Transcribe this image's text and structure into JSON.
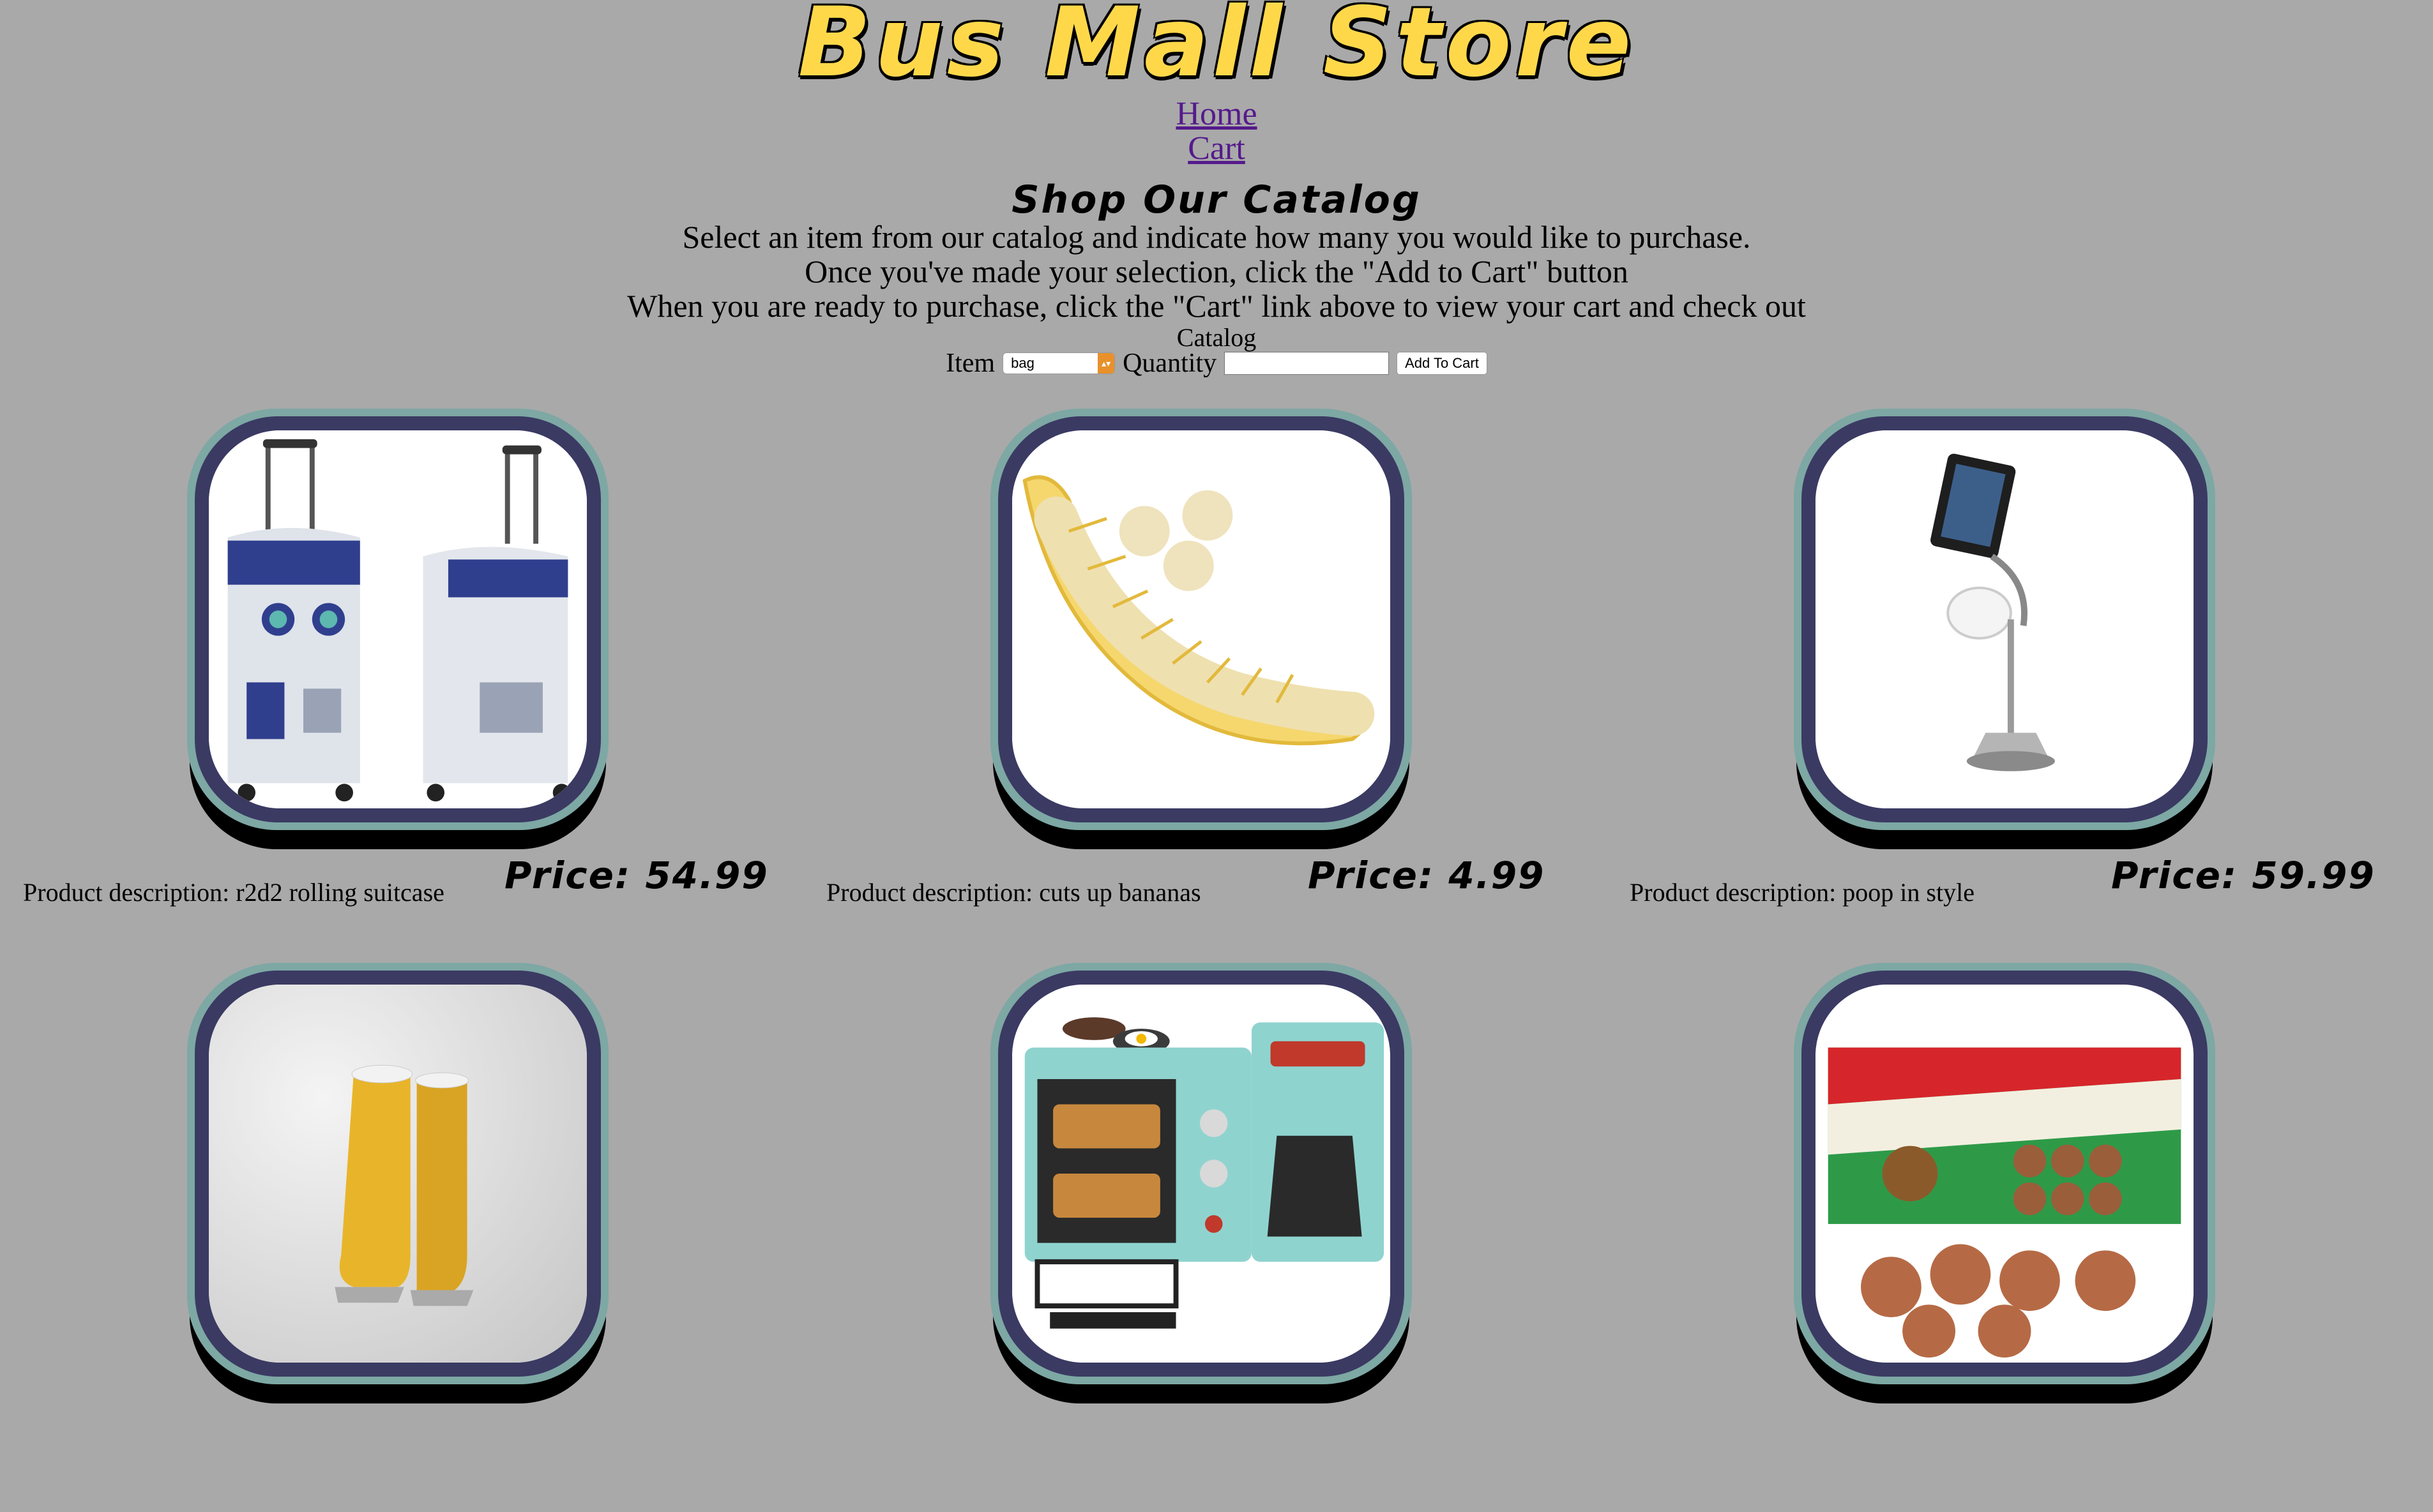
{
  "header": {
    "brand": "Bus Mall Store",
    "nav": [
      "Home",
      "Cart"
    ]
  },
  "catalog": {
    "heading": "Shop Our Catalog",
    "instructions": [
      "Select an item from our catalog and indicate how many you would like to purchase.",
      "Once you've made your selection, click the \"Add to Cart\" button",
      "When you are ready to purchase, click the \"Cart\" link above to view your cart and check out"
    ],
    "form": {
      "caption": "Catalog",
      "item_label": "Item",
      "item_selected": "bag",
      "quantity_label": "Quantity",
      "quantity_value": "",
      "button_label": "Add To Cart"
    }
  },
  "products": [
    {
      "image_icon": "r2d2-suitcase-image",
      "description": "Product description: r2d2 rolling suitcase",
      "price": "Price: 54.99"
    },
    {
      "image_icon": "banana-slicer-image",
      "description": "Product description: cuts up bananas",
      "price": "Price: 4.99"
    },
    {
      "image_icon": "toilet-paper-ipad-stand-image",
      "description": "Product description: poop in style",
      "price": "Price: 59.99"
    },
    {
      "image_icon": "open-toe-boots-image",
      "description": "",
      "price": ""
    },
    {
      "image_icon": "breakfast-maker-image",
      "description": "",
      "price": ""
    },
    {
      "image_icon": "meatball-bubble-gum-image",
      "description": "",
      "price": ""
    }
  ],
  "colors": {
    "background": "#a9a9a9",
    "brand": "#ffd84a",
    "link": "#551a8b",
    "frame_outer": "#7da8a4",
    "frame_inner": "#3b3a63"
  }
}
